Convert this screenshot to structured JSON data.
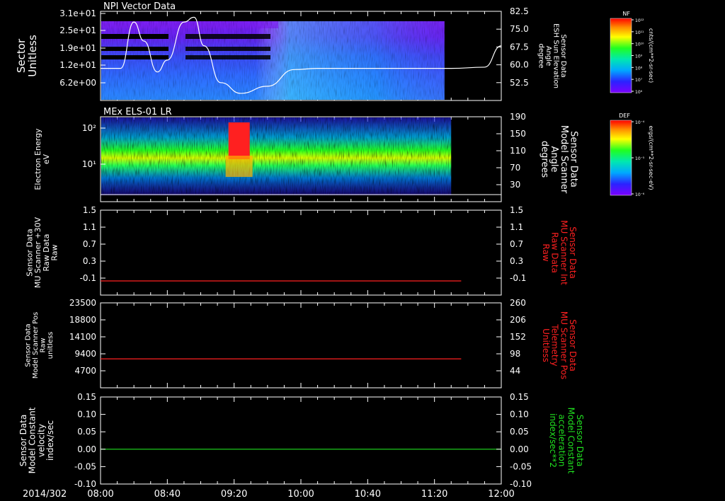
{
  "date": "2014/302",
  "x_ticks": [
    "08:00",
    "08:40",
    "09:20",
    "10:00",
    "10:40",
    "11:20",
    "12:00"
  ],
  "colors": {
    "background": "#000000",
    "axis": "#ffffff",
    "panel3_line": "#ff2020",
    "panel4_line": "#ff2020",
    "panel5_line": "#20e020",
    "red_label": "#ff2020",
    "green_label": "#20e020"
  },
  "colorbars": [
    {
      "title": "NF",
      "unit": "cnts/(cm**2-sr-sec)",
      "ticks": [
        "10¹²",
        "10¹¹",
        "10¹⁰",
        "10⁹",
        "10⁸",
        "10⁷",
        "10⁶"
      ]
    },
    {
      "title": "DEF",
      "unit": "ergs/(cm**2-sr-sec-eV)",
      "ticks": [
        "10⁻⁴",
        "10⁻⁵",
        "10⁻⁶"
      ]
    }
  ],
  "chart_data": [
    {
      "type": "heatmap",
      "title": "NPI Vector Data",
      "ylabel": "Sector\nUnitless",
      "y_ticks": [
        "3.1e+01",
        "2.5e+01",
        "1.9e+01",
        "1.2e+01",
        "6.2e+00"
      ],
      "y2label": "Sensor Data\nESH Sun Elevation\nAngle\ndegree",
      "y2_ticks": [
        "82.5",
        "75.0",
        "67.5",
        "60.0",
        "52.5"
      ],
      "y2lim": [
        45.0,
        82.5
      ],
      "overlay_series": {
        "name": "ESH Sun Elevation Angle",
        "x": [
          "08:00",
          "08:12",
          "08:20",
          "08:26",
          "08:34",
          "08:40",
          "08:50",
          "08:56",
          "09:02",
          "09:12",
          "09:24",
          "09:40",
          "09:56",
          "10:10",
          "11:30",
          "11:50",
          "12:00"
        ],
        "values": [
          58.5,
          58.5,
          78.0,
          70.0,
          57.0,
          62.0,
          78.0,
          80.0,
          68.0,
          52.5,
          48.0,
          51.0,
          58.0,
          58.5,
          58.5,
          59.0,
          68.0
        ]
      }
    },
    {
      "type": "heatmap",
      "title": "MEx ELS-01 LR",
      "ylabel": "Electron Energy\neV",
      "y_ticks": [
        "10²",
        "10¹"
      ],
      "y2label": "Sensor Data\nModel Scanner\nAngle\ndegrees",
      "y2_ticks": [
        "190",
        "150",
        "110",
        "70",
        "30"
      ],
      "overlay_series": {
        "name": "Model Scanner Angle",
        "x": [
          "08:00",
          "12:00"
        ],
        "values": [
          15,
          15
        ]
      }
    },
    {
      "type": "line",
      "ylabel": "Sensor Data\nMU Scanner +30V\nRaw Data\nRaw",
      "y_ticks": [
        "1.5",
        "1.1",
        "0.7",
        "0.3",
        "-0.1"
      ],
      "ylim": [
        -0.3,
        1.5
      ],
      "y2label": "Sensor Data\nMU Scanner Int\nRaw Data\nRaw",
      "y2_ticks": [
        "1.5",
        "1.1",
        "0.7",
        "0.3",
        "-0.1"
      ],
      "series": [
        {
          "x": [
            "08:00",
            "11:36"
          ],
          "values": [
            0.0,
            0.0
          ]
        }
      ]
    },
    {
      "type": "line",
      "ylabel": "Sensor Data\nModel Scanner Pos\nRaw\nunitless",
      "y_ticks": [
        "23500",
        "18800",
        "14100",
        "9400",
        "4700"
      ],
      "ylim": [
        0,
        23500
      ],
      "y2label": "Sensor Data\nMU Scanner Pos\nTelemetry\nUnitless",
      "y2_ticks": [
        "260",
        "206",
        "152",
        "98",
        "44"
      ],
      "series": [
        {
          "x": [
            "08:00",
            "11:36"
          ],
          "values": [
            8000,
            8000
          ]
        }
      ]
    },
    {
      "type": "line",
      "ylabel": "Sensor Data\nModel Constant\nvelocity\nindex/sec",
      "y_ticks": [
        "0.15",
        "0.10",
        "0.05",
        "0.00",
        "-0.05",
        "-0.10"
      ],
      "ylim": [
        -0.1,
        0.15
      ],
      "y2label": "Sensor Data\nModel Constant\nacceleration\nindex/sec**2",
      "y2_ticks": [
        "0.15",
        "0.10",
        "0.05",
        "0.00",
        "-0.05",
        "-0.10"
      ],
      "series": [
        {
          "x": [
            "08:00",
            "12:00"
          ],
          "values": [
            0.0,
            0.0
          ]
        }
      ]
    }
  ]
}
